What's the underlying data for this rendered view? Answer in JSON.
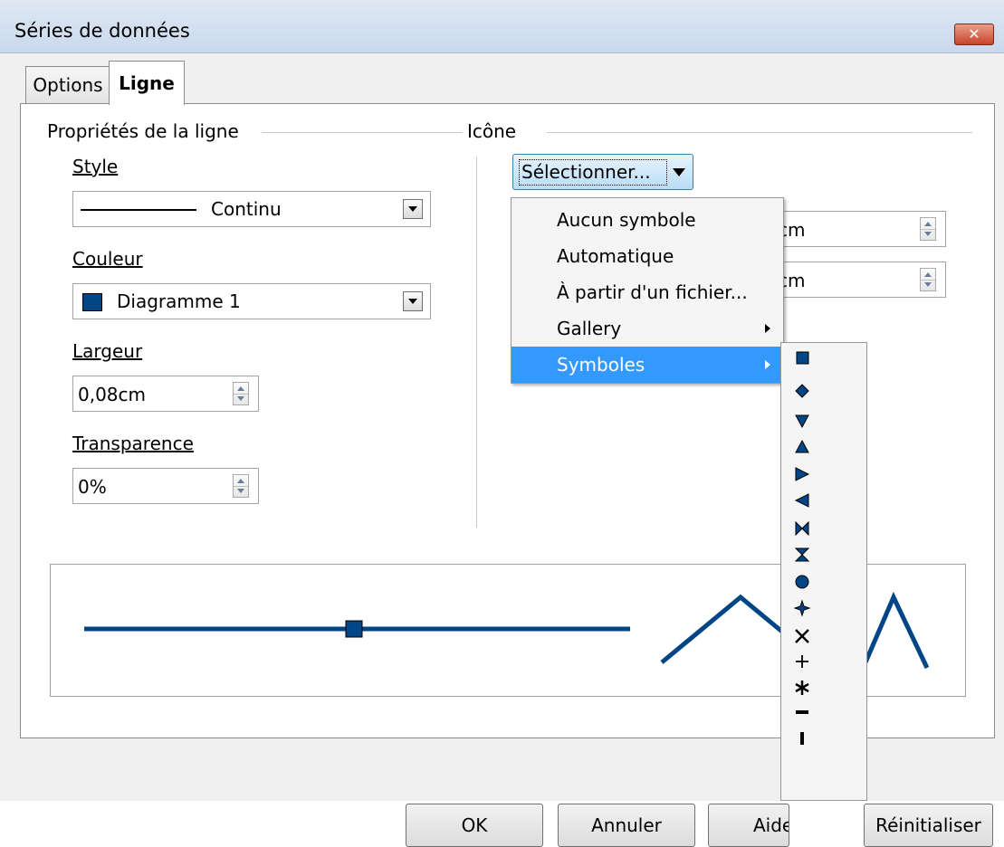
{
  "window": {
    "title": "Séries de données",
    "close_label": "✕"
  },
  "tabs": [
    {
      "label": "Options",
      "active": false
    },
    {
      "label": "Ligne",
      "active": true
    }
  ],
  "line_props": {
    "group_label": "Propriétés de la ligne",
    "style_label": "Style",
    "style_value": "Continu",
    "color_label": "Couleur",
    "color_value": "Diagramme 1",
    "color_swatch": "#004586",
    "width_label": "Largeur",
    "width_value": "0,08cm",
    "transparency_label": "Transparence",
    "transparency_value": "0%"
  },
  "icon": {
    "group_label": "Icône",
    "select_button": "Sélectionner...",
    "width_value_partial": "cm",
    "height_value_partial": "cm"
  },
  "menu": {
    "items": [
      {
        "label": "Aucun symbole",
        "submenu": false,
        "selected": false
      },
      {
        "label": "Automatique",
        "submenu": false,
        "selected": false
      },
      {
        "label": "À partir d'un fichier...",
        "submenu": false,
        "selected": false
      },
      {
        "label": "Gallery",
        "submenu": true,
        "selected": false
      },
      {
        "label": "Symboles",
        "submenu": true,
        "selected": true
      }
    ]
  },
  "symbols": [
    "square",
    "diamond",
    "triangle-down",
    "triangle-up",
    "triangle-right",
    "triangle-left",
    "bowtie",
    "hourglass",
    "circle",
    "star4",
    "x-mark",
    "plus",
    "asterisk",
    "dash",
    "bar"
  ],
  "buttons": {
    "ok": "OK",
    "cancel": "Annuler",
    "help": "Aide",
    "reset": "Réinitialiser"
  },
  "colors": {
    "line": "#004586",
    "menu_highlight": "#3399ff"
  }
}
